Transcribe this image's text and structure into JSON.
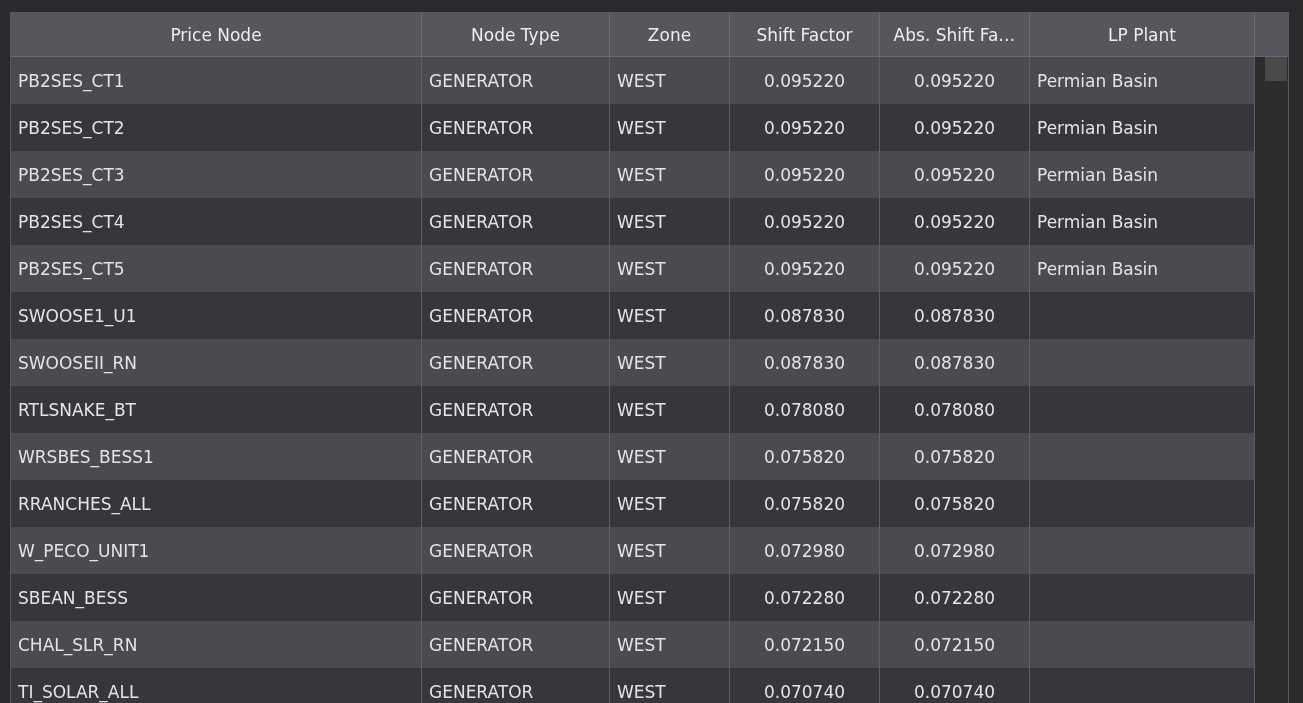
{
  "table": {
    "columns": [
      "Price Node",
      "Node Type",
      "Zone",
      "Shift Factor",
      "Abs. Shift Fa…",
      "LP Plant"
    ],
    "rows": [
      {
        "price_node": "PB2SES_CT1",
        "node_type": "GENERATOR",
        "zone": "WEST",
        "shift_factor": "0.095220",
        "abs_shift_factor": "0.095220",
        "lp_plant": "Permian Basin"
      },
      {
        "price_node": "PB2SES_CT2",
        "node_type": "GENERATOR",
        "zone": "WEST",
        "shift_factor": "0.095220",
        "abs_shift_factor": "0.095220",
        "lp_plant": "Permian Basin"
      },
      {
        "price_node": "PB2SES_CT3",
        "node_type": "GENERATOR",
        "zone": "WEST",
        "shift_factor": "0.095220",
        "abs_shift_factor": "0.095220",
        "lp_plant": "Permian Basin"
      },
      {
        "price_node": "PB2SES_CT4",
        "node_type": "GENERATOR",
        "zone": "WEST",
        "shift_factor": "0.095220",
        "abs_shift_factor": "0.095220",
        "lp_plant": "Permian Basin"
      },
      {
        "price_node": "PB2SES_CT5",
        "node_type": "GENERATOR",
        "zone": "WEST",
        "shift_factor": "0.095220",
        "abs_shift_factor": "0.095220",
        "lp_plant": "Permian Basin"
      },
      {
        "price_node": "SWOOSE1_U1",
        "node_type": "GENERATOR",
        "zone": "WEST",
        "shift_factor": "0.087830",
        "abs_shift_factor": "0.087830"
      },
      {
        "price_node": "SWOOSEII_RN",
        "node_type": "GENERATOR",
        "zone": "WEST",
        "shift_factor": "0.087830",
        "abs_shift_factor": "0.087830"
      },
      {
        "price_node": "RTLSNAKE_BT",
        "node_type": "GENERATOR",
        "zone": "WEST",
        "shift_factor": "0.078080",
        "abs_shift_factor": "0.078080"
      },
      {
        "price_node": "WRSBES_BESS1",
        "node_type": "GENERATOR",
        "zone": "WEST",
        "shift_factor": "0.075820",
        "abs_shift_factor": "0.075820"
      },
      {
        "price_node": "RRANCHES_ALL",
        "node_type": "GENERATOR",
        "zone": "WEST",
        "shift_factor": "0.075820",
        "abs_shift_factor": "0.075820"
      },
      {
        "price_node": "W_PECO_UNIT1",
        "node_type": "GENERATOR",
        "zone": "WEST",
        "shift_factor": "0.072980",
        "abs_shift_factor": "0.072980"
      },
      {
        "price_node": "SBEAN_BESS",
        "node_type": "GENERATOR",
        "zone": "WEST",
        "shift_factor": "0.072280",
        "abs_shift_factor": "0.072280"
      },
      {
        "price_node": "CHAL_SLR_RN",
        "node_type": "GENERATOR",
        "zone": "WEST",
        "shift_factor": "0.072150",
        "abs_shift_factor": "0.072150"
      },
      {
        "price_node": "TI_SOLAR_ALL",
        "node_type": "GENERATOR",
        "zone": "WEST",
        "shift_factor": "0.070740",
        "abs_shift_factor": "0.070740"
      }
    ]
  }
}
